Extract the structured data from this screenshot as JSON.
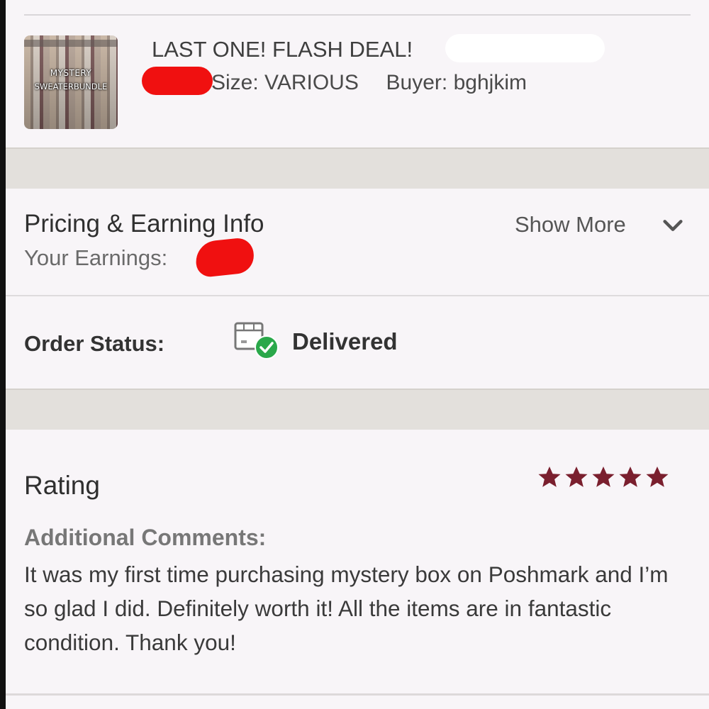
{
  "listing": {
    "thumbnail_caption_line1": "MYSTERY",
    "thumbnail_caption_line2": "SWEATERBUNDLE",
    "title": "LAST ONE! FLASH DEAL!",
    "size_label": "Size:",
    "size_value": "VARIOUS",
    "buyer_label": "Buyer:",
    "buyer_value": "bghjkim"
  },
  "pricing": {
    "title": "Pricing & Earning Info",
    "show_more_label": "Show More",
    "earnings_label": "Your Earnings:"
  },
  "order": {
    "status_label": "Order Status:",
    "status_value": "Delivered",
    "status_icon": "box-delivered-check-icon"
  },
  "rating": {
    "label": "Rating",
    "stars": 5,
    "max_stars": 5,
    "star_color": "#7a1f2e",
    "comments_label": "Additional Comments:",
    "comments_text": "It was my first time purchasing mystery box on Poshmark and I’m so glad I did. Definitely worth it! All the items are in fantastic condition. Thank you!"
  },
  "colors": {
    "status_check": "#2aa84a",
    "redaction": "#f01010"
  }
}
